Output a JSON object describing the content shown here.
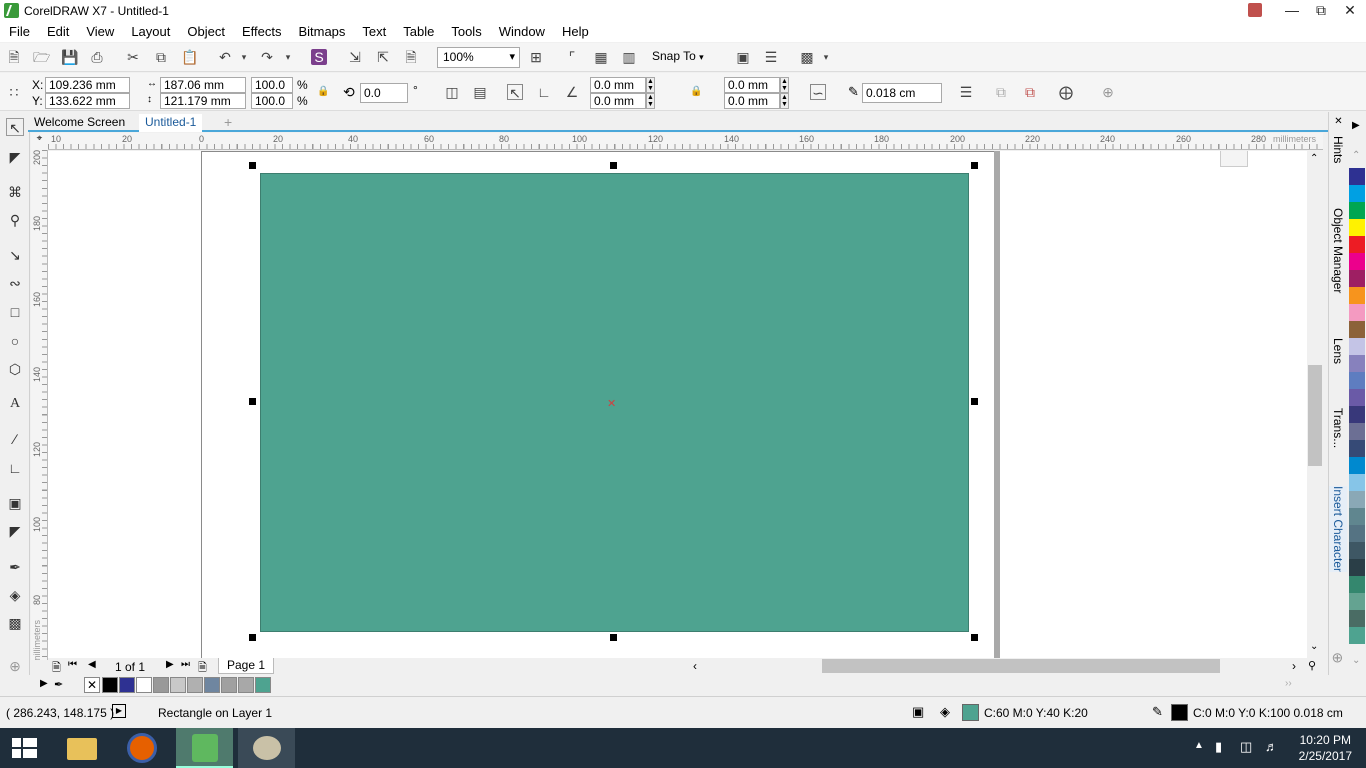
{
  "window": {
    "title": "CorelDRAW X7 - Untitled-1"
  },
  "menu": [
    "File",
    "Edit",
    "View",
    "Layout",
    "Object",
    "Effects",
    "Bitmaps",
    "Text",
    "Table",
    "Tools",
    "Window",
    "Help"
  ],
  "toolbar": {
    "zoom": "100%",
    "snap_to": "Snap To"
  },
  "props": {
    "x": "109.236 mm",
    "y": "133.622 mm",
    "x_label": "X:",
    "y_label": "Y:",
    "width": "187.06 mm",
    "height": "121.179 mm",
    "scale_w": "100.0",
    "scale_h": "100.0",
    "percent": "%",
    "rotation": "0.0",
    "degree": "°",
    "corner1": "0.0 mm",
    "corner2": "0.0 mm",
    "corner3": "0.0 mm",
    "corner4": "0.0 mm",
    "outline": "0.018 cm"
  },
  "tabs": {
    "welcome": "Welcome Screen",
    "doc": "Untitled-1"
  },
  "ruler": {
    "h_labels": [
      "10",
      "20",
      "0",
      "20",
      "40",
      "60",
      "80",
      "100",
      "120",
      "140",
      "160",
      "180",
      "200",
      "220",
      "240",
      "260",
      "280"
    ],
    "unit": "millimeters",
    "v_labels": [
      "200",
      "180",
      "160",
      "140",
      "120",
      "100",
      "80"
    ],
    "v_unit": "millimeters"
  },
  "page_nav": {
    "count": "1 of 1",
    "page": "Page 1"
  },
  "docker": {
    "hints": "Hints",
    "object_manager": "Object Manager",
    "lens": "Lens",
    "trans": "Trans...",
    "insert_character": "Insert Character"
  },
  "palette_colors": [
    "#2e3192",
    "#00a0e3",
    "#00a651",
    "#fff200",
    "#ed1c24",
    "#ec008c",
    "#9e1f63",
    "#f7941d",
    "#f49ac1",
    "#8c6239",
    "#c4c4e6",
    "#8781bd",
    "#5e7dc0",
    "#6a5aa7",
    "#38387a",
    "#6c6f94",
    "#364a76",
    "#0089cf",
    "#86c5e8",
    "#8aa8b6",
    "#60868f",
    "#557383",
    "#3e5764",
    "#2a3e47",
    "#34876e",
    "#64a391",
    "#4a6c64",
    "#4ea390"
  ],
  "doc_palette": [
    "#000000",
    "#2e3192",
    "#ffffff",
    "#999999",
    "#c8c8c8",
    "#b0b0b0",
    "#6f86a0",
    "#a0a0a0",
    "#a8a8a8",
    "#4ea390"
  ],
  "status": {
    "coords": "( 286.243, 148.175 )",
    "selection": "Rectangle on Layer 1",
    "fill_color_hex": "#4ea390",
    "fill": "C:60 M:0 Y:40 K:20",
    "outline_color_hex": "#000000",
    "outline": "C:0 M:0 Y:0 K:100  0.018 cm"
  },
  "clock": {
    "time": "10:20 PM",
    "date": "2/25/2017"
  }
}
